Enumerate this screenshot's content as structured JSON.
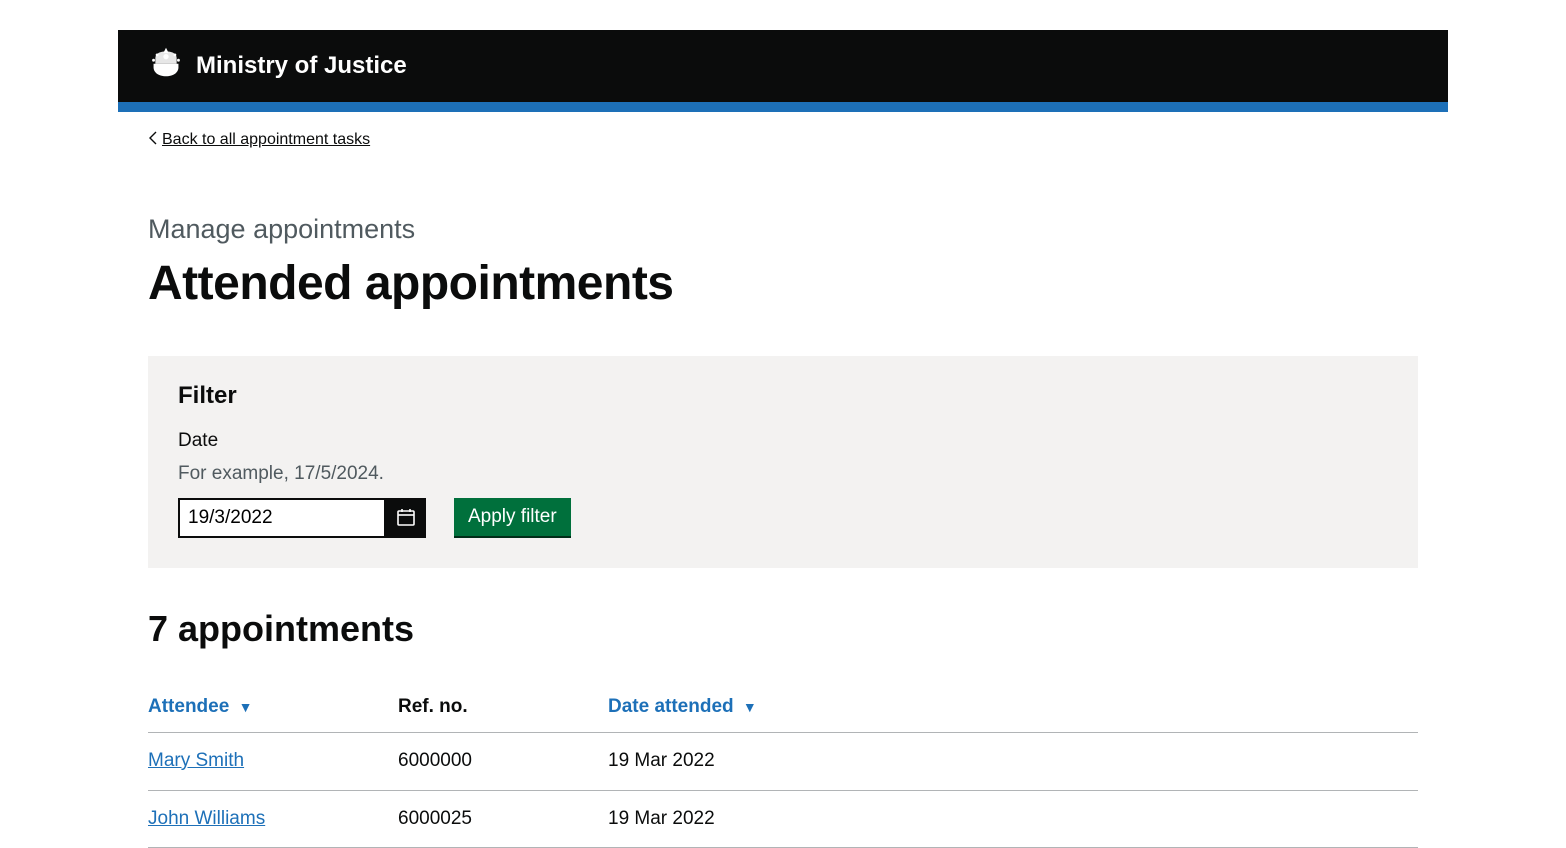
{
  "header": {
    "org_name": "Ministry of Justice"
  },
  "back_link": {
    "label": "Back to all appointment tasks"
  },
  "page": {
    "caption": "Manage appointments",
    "title": "Attended appointments"
  },
  "filter": {
    "heading": "Filter",
    "date_label": "Date",
    "date_hint": "For example, 17/5/2024.",
    "date_value": "19/3/2022",
    "apply_label": "Apply filter"
  },
  "results": {
    "heading": "7 appointments",
    "columns": {
      "attendee": "Attendee",
      "ref": "Ref. no.",
      "date": "Date attended"
    },
    "sort_indicator": "▼",
    "rows": [
      {
        "attendee": "Mary Smith",
        "ref": "6000000",
        "date": "19 Mar 2022"
      },
      {
        "attendee": "John Williams",
        "ref": "6000025",
        "date": "19 Mar 2022"
      }
    ]
  }
}
